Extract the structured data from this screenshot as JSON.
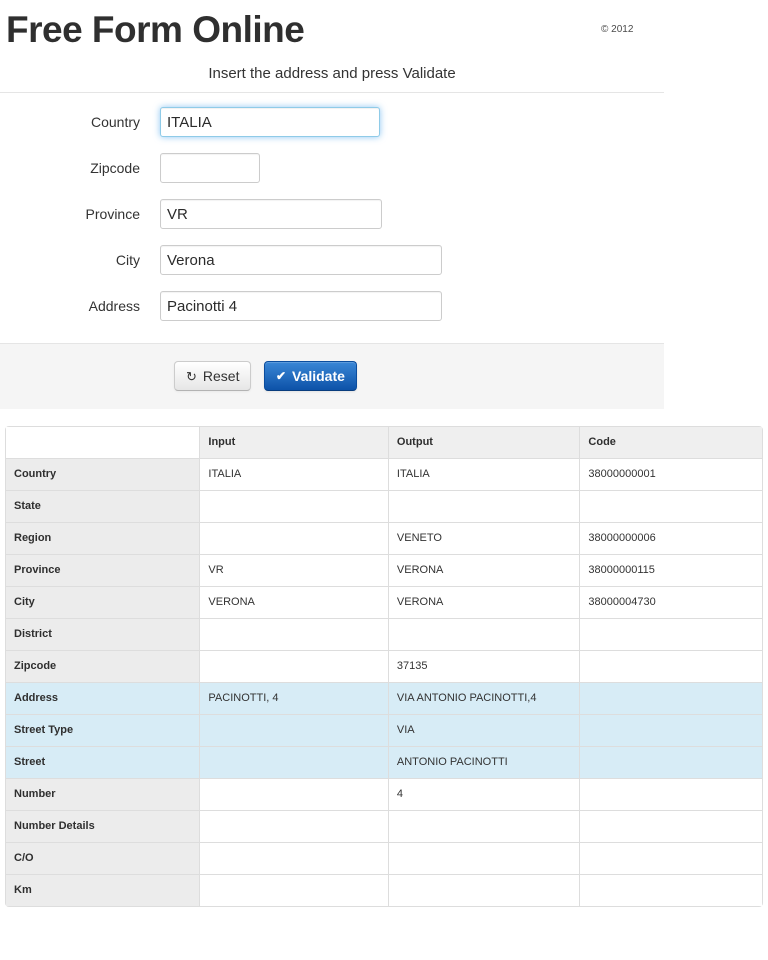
{
  "header": {
    "title": "Free Form Online",
    "copyright": "© 2012"
  },
  "form": {
    "legend": "Insert the address and press Validate",
    "fields": [
      {
        "label": "Country",
        "value": "ITALIA",
        "placeholder": "",
        "focused": true
      },
      {
        "label": "Zipcode",
        "value": "",
        "placeholder": "",
        "focused": false
      },
      {
        "label": "Province",
        "value": "VR",
        "placeholder": "",
        "focused": false
      },
      {
        "label": "City",
        "value": "Verona",
        "placeholder": "",
        "focused": false
      },
      {
        "label": "Address",
        "value": "Pacinotti 4",
        "placeholder": "",
        "focused": false
      }
    ],
    "actions": {
      "reset_label": "Reset",
      "reset_icon": "refresh-icon",
      "reset_glyph": "↻",
      "validate_label": "Validate",
      "validate_icon": "check-icon",
      "validate_glyph": "✔"
    }
  },
  "result_table": {
    "columns": [
      "",
      "Input",
      "Output",
      "Code"
    ],
    "rows": [
      {
        "label": "Country",
        "input": "ITALIA",
        "output": "ITALIA",
        "code": "38000000001",
        "highlight": false
      },
      {
        "label": "State",
        "input": "",
        "output": "",
        "code": "",
        "highlight": false
      },
      {
        "label": "Region",
        "input": "",
        "output": "VENETO",
        "code": "38000000006",
        "highlight": false
      },
      {
        "label": "Province",
        "input": "VR",
        "output": "VERONA",
        "code": "38000000115",
        "highlight": false
      },
      {
        "label": "City",
        "input": "VERONA",
        "output": "VERONA",
        "code": "38000004730",
        "highlight": false
      },
      {
        "label": "District",
        "input": "",
        "output": "",
        "code": "",
        "highlight": false
      },
      {
        "label": "Zipcode",
        "input": "",
        "output": "37135",
        "code": "",
        "highlight": false
      },
      {
        "label": "Address",
        "input": "PACINOTTI, 4",
        "output": "VIA ANTONIO PACINOTTI,4",
        "code": "",
        "highlight": true
      },
      {
        "label": "Street Type",
        "input": "",
        "output": "VIA",
        "code": "",
        "highlight": true
      },
      {
        "label": "Street",
        "input": "",
        "output": "ANTONIO PACINOTTI",
        "code": "",
        "highlight": true
      },
      {
        "label": "Number",
        "input": "",
        "output": "4",
        "code": "",
        "highlight": false
      },
      {
        "label": "Number Details",
        "input": "",
        "output": "",
        "code": "",
        "highlight": false
      },
      {
        "label": "C/O",
        "input": "",
        "output": "",
        "code": "",
        "highlight": false
      },
      {
        "label": "Km",
        "input": "",
        "output": "",
        "code": "",
        "highlight": false
      }
    ]
  },
  "colors": {
    "highlight_row": "#d7ecf6",
    "header_row": "#efefef",
    "label_cell": "#ececec",
    "primary_button": "#1768c0",
    "focus_ring": "#52a8ec"
  }
}
